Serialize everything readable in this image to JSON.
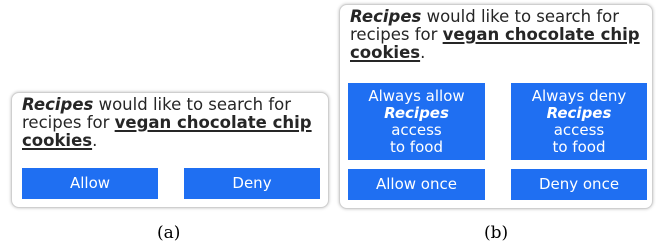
{
  "panel_a": {
    "message": {
      "app_name": "Recipes",
      "text_before_query": " would like to search for recipes for ",
      "query": "vegan chocolate chip cookies",
      "text_after_query": "."
    },
    "allow_label": "Allow",
    "deny_label": "Deny"
  },
  "panel_b": {
    "message": {
      "app_name": "Recipes",
      "text_before_query": " would like to search for recipes for ",
      "query": "vegan chocolate chip cookies",
      "text_after_query": "."
    },
    "always_allow": {
      "prefix": "Always allow",
      "app_name": "Recipes",
      "suffix": "access to food"
    },
    "always_deny": {
      "prefix": "Always deny",
      "app_name": "Recipes",
      "suffix": "access to food"
    },
    "allow_once_label": "Allow once",
    "deny_once_label": "Deny once"
  },
  "captions": {
    "a": "(a)",
    "b": "(b)"
  },
  "colors": {
    "button_blue": "#1f6ff2",
    "panel_border": "#cfcfcf"
  }
}
